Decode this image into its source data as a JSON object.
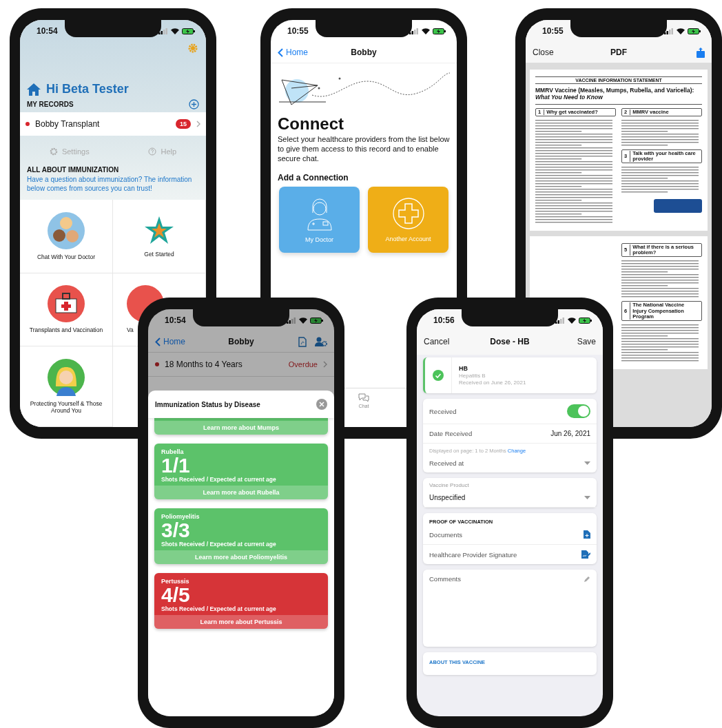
{
  "home_screen": {
    "time": "10:54",
    "greeting": "Hi Beta Tester",
    "records_heading": "MY RECORDS",
    "records": [
      {
        "name": "Bobby Transplant",
        "badge": "15"
      }
    ],
    "links": [
      "Settings",
      "Help"
    ],
    "info_heading": "ALL ABOUT IMMUNIZATION",
    "info_text": "Have a question about immunization? The information below comes from sources you can trust!",
    "tiles": [
      "Chat With Your Doctor",
      "Get Started",
      "Transplants and Vaccination",
      "Va",
      "Protecting Yourself & Those Around You"
    ]
  },
  "connect_screen": {
    "time": "10:55",
    "back": "Home",
    "title": "Bobby",
    "heading": "Connect",
    "text": "Select your healthcare providers from the list below to give them access to this record and to enable secure chat.",
    "section": "Add a Connection",
    "options": [
      {
        "label": "My Doctor",
        "color": "#5aaee8"
      },
      {
        "label": "Another Account",
        "color": "#efae17"
      }
    ],
    "tab_bar": [
      "Chat"
    ]
  },
  "pdf_screen": {
    "time": "10:55",
    "close": "Close",
    "title": "PDF",
    "document": {
      "header": "VACCINE INFORMATION STATEMENT",
      "title": "MMRV Vaccine (Measles, Mumps, Rubella, and Varicella): *What You Need to Know*",
      "pages": [
        {
          "left_sections": [
            {
              "number": "1",
              "title": "Why get vaccinated?"
            }
          ],
          "right_sections": [
            {
              "number": "2",
              "title": "MMRV vaccine"
            },
            {
              "number": "3",
              "title": "Talk with your health care provider"
            }
          ]
        },
        {
          "right_sections": [
            {
              "number": "5",
              "title": "What if there is a serious problem?"
            },
            {
              "number": "6",
              "title": "The National Vaccine Injury Compensation Program"
            }
          ]
        }
      ]
    }
  },
  "status_screen": {
    "time": "10:54",
    "back": "Home",
    "title": "Bobby",
    "rows": [
      {
        "label": "18 Months to 4 Years",
        "status": "Overdue"
      }
    ],
    "sheet": {
      "title": "Immunization Status by Disease",
      "cards": [
        {
          "link": "Learn more about Mumps",
          "color": "#5cc26a"
        },
        {
          "name": "Rubella",
          "count": "1/1",
          "caption": "Shots Received / Expected at current age",
          "link": "Learn more about Rubella",
          "color": "#5cc26a"
        },
        {
          "name": "Poliomyelitis",
          "count": "3/3",
          "caption": "Shots Received / Expected at current age",
          "link": "Learn more about Poliomyelitis",
          "color": "#5cc26a"
        },
        {
          "name": "Pertussis",
          "count": "4/5",
          "caption": "Shots Received / Expected at current age",
          "link": "Learn more about Pertussis",
          "color": "#d63438"
        }
      ]
    }
  },
  "dose_screen": {
    "time": "10:56",
    "cancel": "Cancel",
    "title": "Dose - HB",
    "save": "Save",
    "vaccine": {
      "code": "HB",
      "name": "Hepatitis B",
      "received": "Received on June 26, 2021"
    },
    "received": {
      "label": "Received",
      "on": true
    },
    "date": {
      "label": "Date Received",
      "value": "Jun 26, 2021"
    },
    "display_note": "Displayed on page: 1 to 2 Months",
    "change_link": "Change",
    "received_at": {
      "label": "Received at"
    },
    "product": {
      "label": "Vaccine Product",
      "value": "Unspecified"
    },
    "proof": {
      "heading": "PROOF OF VACCINATION",
      "items": [
        "Documents",
        "Healthcare Provider Signature"
      ]
    },
    "comments": {
      "label": "Comments"
    },
    "about": "ABOUT THIS VACCINE"
  }
}
